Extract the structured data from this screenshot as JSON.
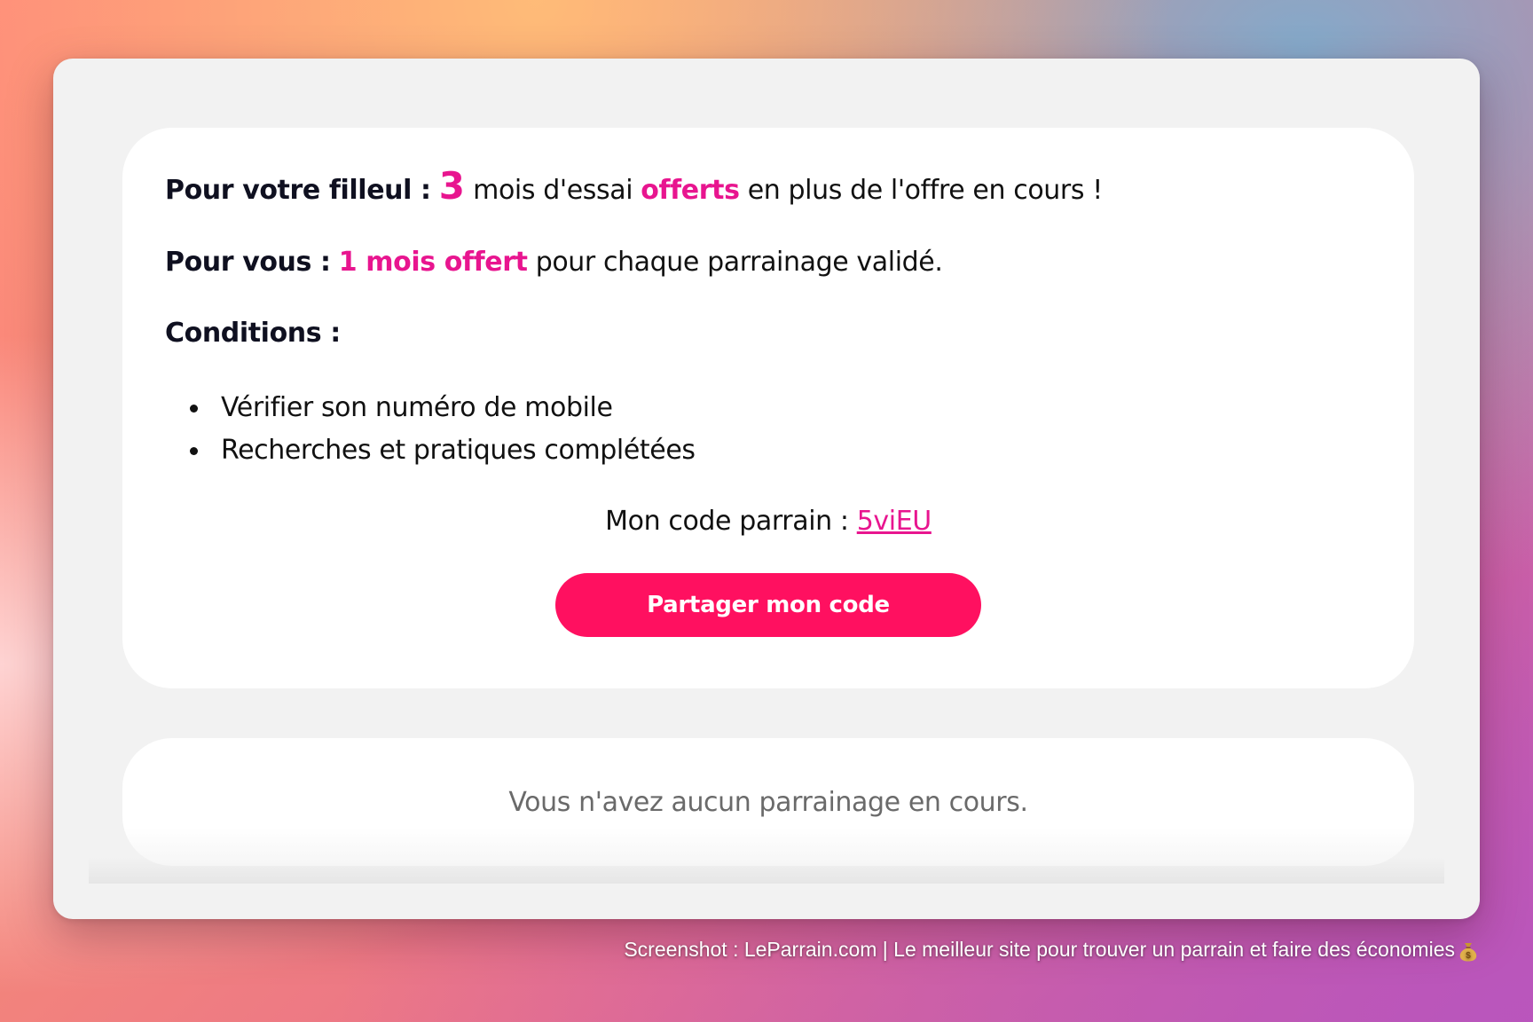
{
  "referral": {
    "filleul_label": "Pour votre filleul :",
    "filleul_months": "3",
    "filleul_text_1": "mois d'essai",
    "filleul_offerts": "offerts",
    "filleul_text_2": "en plus de l'offre en cours !",
    "vous_label": "Pour vous :",
    "vous_offer": "1 mois offert",
    "vous_text": "pour chaque parrainage validé.",
    "conditions_label": "Conditions :",
    "conditions": [
      "Vérifier son numéro de mobile",
      "Recherches et pratiques complétées"
    ],
    "code_label": "Mon code parrain :",
    "code_value": "5viEU",
    "share_button_label": "Partager mon code"
  },
  "status": {
    "empty_message": "Vous n'avez aucun parrainage en cours."
  },
  "caption": {
    "text": "Screenshot : LeParrain.com | Le meilleur site pour trouver un parrain et faire des économies",
    "icon": "moneybag-icon"
  },
  "colors": {
    "accent_pink": "#e8158f",
    "button_red": "#ff1060"
  }
}
